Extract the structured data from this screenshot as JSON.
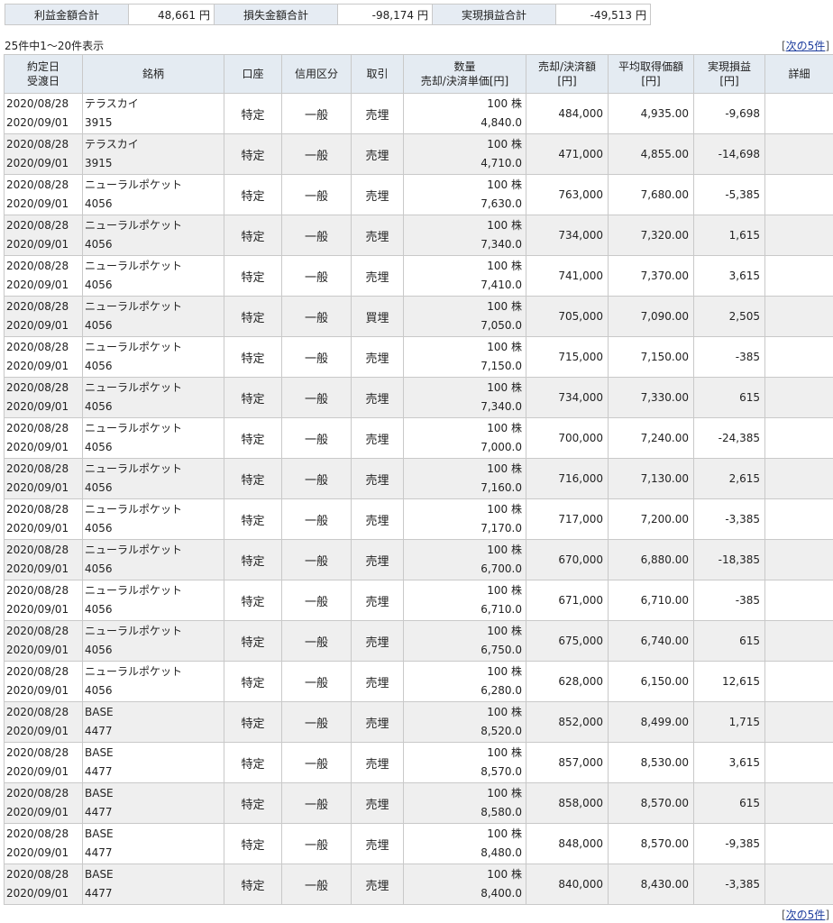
{
  "summary": {
    "profit_label": "利益金額合計",
    "profit_value": "48,661",
    "loss_label": "損失金額合計",
    "loss_value": "-98,174",
    "net_label": "実現損益合計",
    "net_value": "-49,513",
    "unit": "円"
  },
  "pagination": {
    "count_text": "25件中1～20件表示",
    "next_bracket_open": "[",
    "next_label": "次の5件",
    "next_bracket_close": "]"
  },
  "headers": {
    "date_1": "約定日",
    "date_2": "受渡日",
    "name": "銘柄",
    "account": "口座",
    "credit": "信用区分",
    "trade": "取引",
    "qty_1": "数量",
    "qty_2": "売却/決済単価[円]",
    "amount_1": "売却/決済額",
    "amount_2": "[円]",
    "avg_1": "平均取得価額",
    "avg_2": "[円]",
    "pl_1": "実現損益",
    "pl_2": "[円]",
    "detail": "詳細"
  },
  "rows": [
    {
      "trade_date": "2020/08/28",
      "settle_date": "2020/09/01",
      "name": "テラスカイ",
      "code": "3915",
      "account": "特定",
      "credit": "一般",
      "trade": "売埋",
      "qty": "100 株",
      "price": "4,840.0",
      "amount": "484,000",
      "avg_cost": "4,935.00",
      "pl": "-9,698"
    },
    {
      "trade_date": "2020/08/28",
      "settle_date": "2020/09/01",
      "name": "テラスカイ",
      "code": "3915",
      "account": "特定",
      "credit": "一般",
      "trade": "売埋",
      "qty": "100 株",
      "price": "4,710.0",
      "amount": "471,000",
      "avg_cost": "4,855.00",
      "pl": "-14,698"
    },
    {
      "trade_date": "2020/08/28",
      "settle_date": "2020/09/01",
      "name": "ニューラルポケット",
      "code": "4056",
      "account": "特定",
      "credit": "一般",
      "trade": "売埋",
      "qty": "100 株",
      "price": "7,630.0",
      "amount": "763,000",
      "avg_cost": "7,680.00",
      "pl": "-5,385"
    },
    {
      "trade_date": "2020/08/28",
      "settle_date": "2020/09/01",
      "name": "ニューラルポケット",
      "code": "4056",
      "account": "特定",
      "credit": "一般",
      "trade": "売埋",
      "qty": "100 株",
      "price": "7,340.0",
      "amount": "734,000",
      "avg_cost": "7,320.00",
      "pl": "1,615"
    },
    {
      "trade_date": "2020/08/28",
      "settle_date": "2020/09/01",
      "name": "ニューラルポケット",
      "code": "4056",
      "account": "特定",
      "credit": "一般",
      "trade": "売埋",
      "qty": "100 株",
      "price": "7,410.0",
      "amount": "741,000",
      "avg_cost": "7,370.00",
      "pl": "3,615"
    },
    {
      "trade_date": "2020/08/28",
      "settle_date": "2020/09/01",
      "name": "ニューラルポケット",
      "code": "4056",
      "account": "特定",
      "credit": "一般",
      "trade": "買埋",
      "qty": "100 株",
      "price": "7,050.0",
      "amount": "705,000",
      "avg_cost": "7,090.00",
      "pl": "2,505"
    },
    {
      "trade_date": "2020/08/28",
      "settle_date": "2020/09/01",
      "name": "ニューラルポケット",
      "code": "4056",
      "account": "特定",
      "credit": "一般",
      "trade": "売埋",
      "qty": "100 株",
      "price": "7,150.0",
      "amount": "715,000",
      "avg_cost": "7,150.00",
      "pl": "-385"
    },
    {
      "trade_date": "2020/08/28",
      "settle_date": "2020/09/01",
      "name": "ニューラルポケット",
      "code": "4056",
      "account": "特定",
      "credit": "一般",
      "trade": "売埋",
      "qty": "100 株",
      "price": "7,340.0",
      "amount": "734,000",
      "avg_cost": "7,330.00",
      "pl": "615"
    },
    {
      "trade_date": "2020/08/28",
      "settle_date": "2020/09/01",
      "name": "ニューラルポケット",
      "code": "4056",
      "account": "特定",
      "credit": "一般",
      "trade": "売埋",
      "qty": "100 株",
      "price": "7,000.0",
      "amount": "700,000",
      "avg_cost": "7,240.00",
      "pl": "-24,385"
    },
    {
      "trade_date": "2020/08/28",
      "settle_date": "2020/09/01",
      "name": "ニューラルポケット",
      "code": "4056",
      "account": "特定",
      "credit": "一般",
      "trade": "売埋",
      "qty": "100 株",
      "price": "7,160.0",
      "amount": "716,000",
      "avg_cost": "7,130.00",
      "pl": "2,615"
    },
    {
      "trade_date": "2020/08/28",
      "settle_date": "2020/09/01",
      "name": "ニューラルポケット",
      "code": "4056",
      "account": "特定",
      "credit": "一般",
      "trade": "売埋",
      "qty": "100 株",
      "price": "7,170.0",
      "amount": "717,000",
      "avg_cost": "7,200.00",
      "pl": "-3,385"
    },
    {
      "trade_date": "2020/08/28",
      "settle_date": "2020/09/01",
      "name": "ニューラルポケット",
      "code": "4056",
      "account": "特定",
      "credit": "一般",
      "trade": "売埋",
      "qty": "100 株",
      "price": "6,700.0",
      "amount": "670,000",
      "avg_cost": "6,880.00",
      "pl": "-18,385"
    },
    {
      "trade_date": "2020/08/28",
      "settle_date": "2020/09/01",
      "name": "ニューラルポケット",
      "code": "4056",
      "account": "特定",
      "credit": "一般",
      "trade": "売埋",
      "qty": "100 株",
      "price": "6,710.0",
      "amount": "671,000",
      "avg_cost": "6,710.00",
      "pl": "-385"
    },
    {
      "trade_date": "2020/08/28",
      "settle_date": "2020/09/01",
      "name": "ニューラルポケット",
      "code": "4056",
      "account": "特定",
      "credit": "一般",
      "trade": "売埋",
      "qty": "100 株",
      "price": "6,750.0",
      "amount": "675,000",
      "avg_cost": "6,740.00",
      "pl": "615"
    },
    {
      "trade_date": "2020/08/28",
      "settle_date": "2020/09/01",
      "name": "ニューラルポケット",
      "code": "4056",
      "account": "特定",
      "credit": "一般",
      "trade": "売埋",
      "qty": "100 株",
      "price": "6,280.0",
      "amount": "628,000",
      "avg_cost": "6,150.00",
      "pl": "12,615"
    },
    {
      "trade_date": "2020/08/28",
      "settle_date": "2020/09/01",
      "name": "BASE",
      "code": "4477",
      "account": "特定",
      "credit": "一般",
      "trade": "売埋",
      "qty": "100 株",
      "price": "8,520.0",
      "amount": "852,000",
      "avg_cost": "8,499.00",
      "pl": "1,715"
    },
    {
      "trade_date": "2020/08/28",
      "settle_date": "2020/09/01",
      "name": "BASE",
      "code": "4477",
      "account": "特定",
      "credit": "一般",
      "trade": "売埋",
      "qty": "100 株",
      "price": "8,570.0",
      "amount": "857,000",
      "avg_cost": "8,530.00",
      "pl": "3,615"
    },
    {
      "trade_date": "2020/08/28",
      "settle_date": "2020/09/01",
      "name": "BASE",
      "code": "4477",
      "account": "特定",
      "credit": "一般",
      "trade": "売埋",
      "qty": "100 株",
      "price": "8,580.0",
      "amount": "858,000",
      "avg_cost": "8,570.00",
      "pl": "615"
    },
    {
      "trade_date": "2020/08/28",
      "settle_date": "2020/09/01",
      "name": "BASE",
      "code": "4477",
      "account": "特定",
      "credit": "一般",
      "trade": "売埋",
      "qty": "100 株",
      "price": "8,480.0",
      "amount": "848,000",
      "avg_cost": "8,570.00",
      "pl": "-9,385"
    },
    {
      "trade_date": "2020/08/28",
      "settle_date": "2020/09/01",
      "name": "BASE",
      "code": "4477",
      "account": "特定",
      "credit": "一般",
      "trade": "売埋",
      "qty": "100 株",
      "price": "8,400.0",
      "amount": "840,000",
      "avg_cost": "8,430.00",
      "pl": "-3,385"
    }
  ]
}
